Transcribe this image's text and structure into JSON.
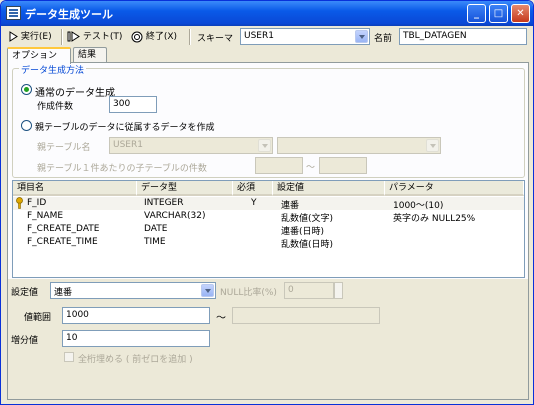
{
  "window": {
    "title": "データ生成ツール"
  },
  "toolbar": {
    "run_label": "実行(E)",
    "test_label": "テスト(T)",
    "exit_label": "終了(X)",
    "schema_label": "スキーマ",
    "schema_value": "USER1",
    "name_label": "名前",
    "name_value": "TBL_DATAGEN"
  },
  "tabs": [
    {
      "label": "オプション"
    },
    {
      "label": "結果"
    }
  ],
  "generation": {
    "legend": "データ生成方法",
    "normal_label": "通常のデータ生成",
    "count_label": "作成件数",
    "count_value": "300",
    "child_label": "親テーブルのデータに従属するデータを作成",
    "parent_table_label": "親テーブル名",
    "parent_schema_value": "USER1",
    "per_parent_label": "親テーブル１件あたりの子テーブルの件数",
    "range_sep": "～"
  },
  "grid": {
    "headers": [
      "項目名",
      "データ型",
      "必須",
      "設定値",
      "パラメータ"
    ],
    "rows": [
      {
        "name": "F_ID",
        "type": "INTEGER",
        "required": "Y",
        "setting": "連番",
        "param": "1000～(10)"
      },
      {
        "name": "F_NAME",
        "type": "VARCHAR(32)",
        "required": "",
        "setting": "乱数値(文字)",
        "param": "英字のみ NULL25%"
      },
      {
        "name": "F_CREATE_DATE",
        "type": "DATE",
        "required": "",
        "setting": "連番(日時)",
        "param": ""
      },
      {
        "name": "F_CREATE_TIME",
        "type": "TIME",
        "required": "",
        "setting": "乱数値(日時)",
        "param": ""
      }
    ]
  },
  "settings": {
    "setting_label": "設定値",
    "setting_value": "連番",
    "null_ratio_label": "NULL比率(%)",
    "null_ratio_value": "0",
    "range_label": "値範囲",
    "range_from": "1000",
    "range_sep": "～",
    "increment_label": "増分値",
    "increment_value": "10",
    "zero_fill_label": "全桁埋める ( 前ゼロを追加 )"
  },
  "colors": {
    "title_bar": "#0a5ae8",
    "accent_legend": "#0046d5",
    "radio_dot": "#21a121",
    "key_icon": "#e0a800"
  }
}
